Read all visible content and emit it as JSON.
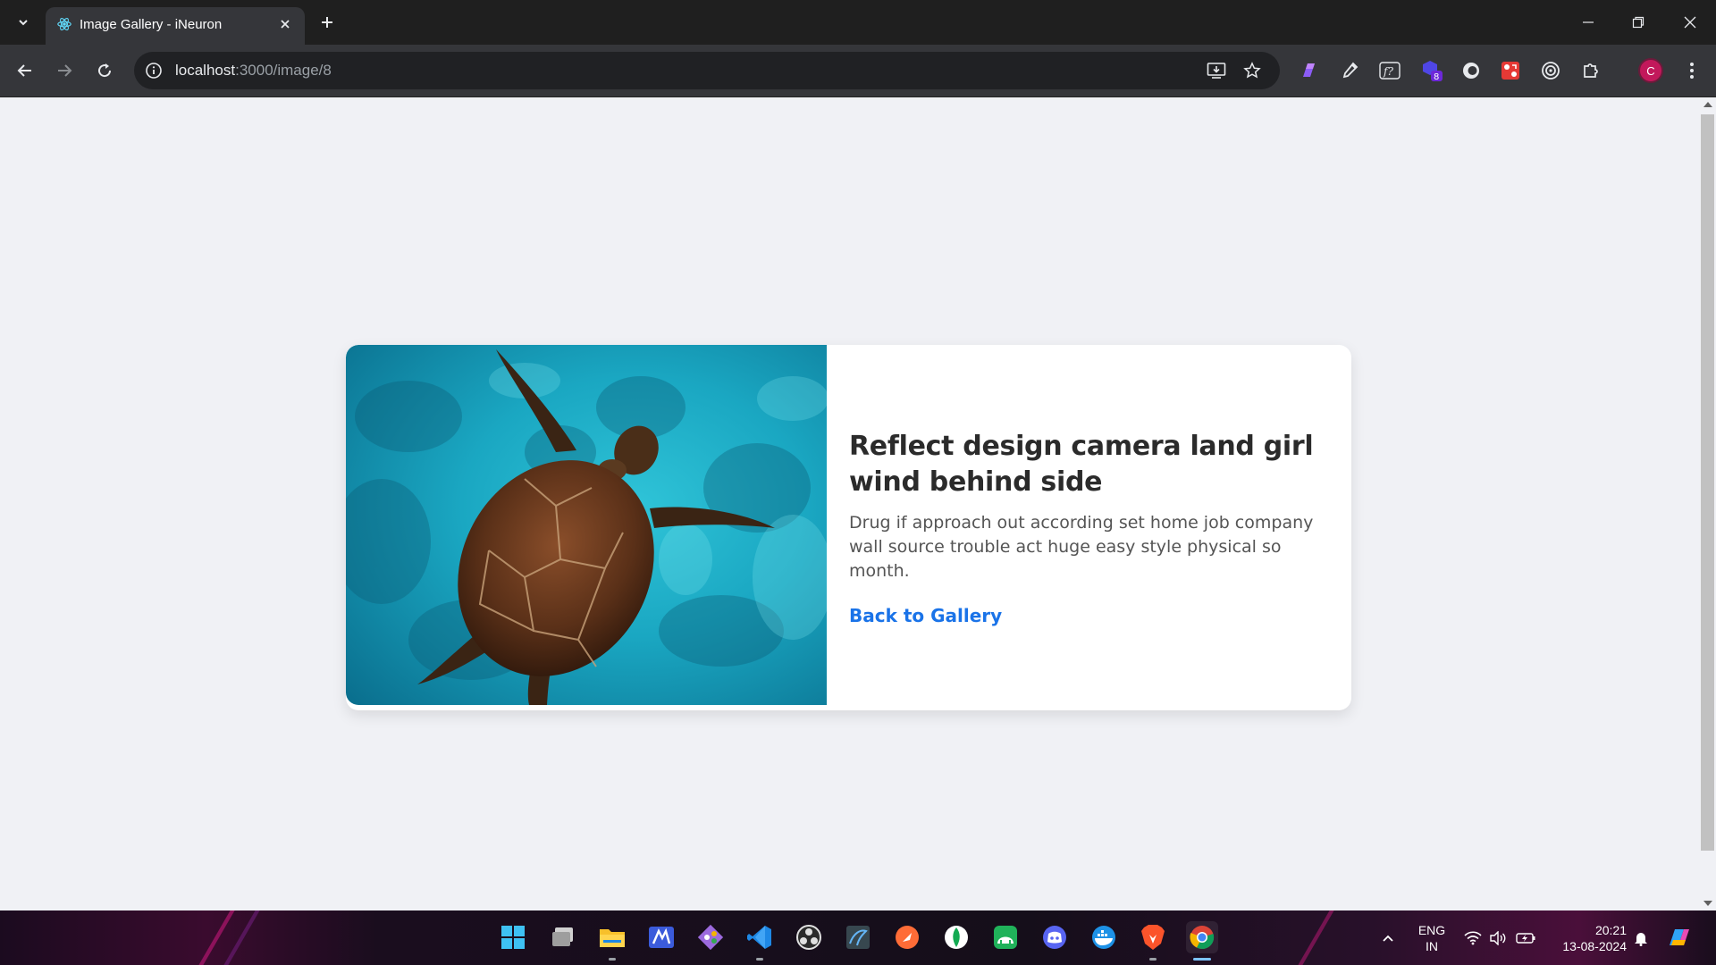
{
  "browser": {
    "tab_title": "Image Gallery - iNeuron",
    "url_host": "localhost",
    "url_path": ":3000/image/8",
    "extension_badge_count": "8",
    "profile_initial": "C"
  },
  "page": {
    "image_alt": "Sea turtle swimming over reef",
    "title": "Reflect design camera land girl wind behind side",
    "description": "Drug if approach out according set home job company wall source trouble act huge easy style physical so month.",
    "back_link": "Back to Gallery"
  },
  "taskbar": {
    "apps": [
      "start-icon",
      "task-view-icon",
      "file-explorer-icon",
      "vs-code-alt-icon",
      "git-icon",
      "vscode-icon",
      "obs-icon",
      "mysql-workbench-icon",
      "postman-icon",
      "mongodb-compass-icon",
      "android-studio-icon",
      "discord-icon",
      "docker-icon",
      "brave-icon",
      "chrome-icon"
    ],
    "lang_line1": "ENG",
    "lang_line2": "IN",
    "time": "20:21",
    "date": "13-08-2024"
  },
  "colors": {
    "accent_link": "#1a73e8",
    "title_text": "#2b2b2b",
    "page_bg": "#f0f1f5"
  }
}
